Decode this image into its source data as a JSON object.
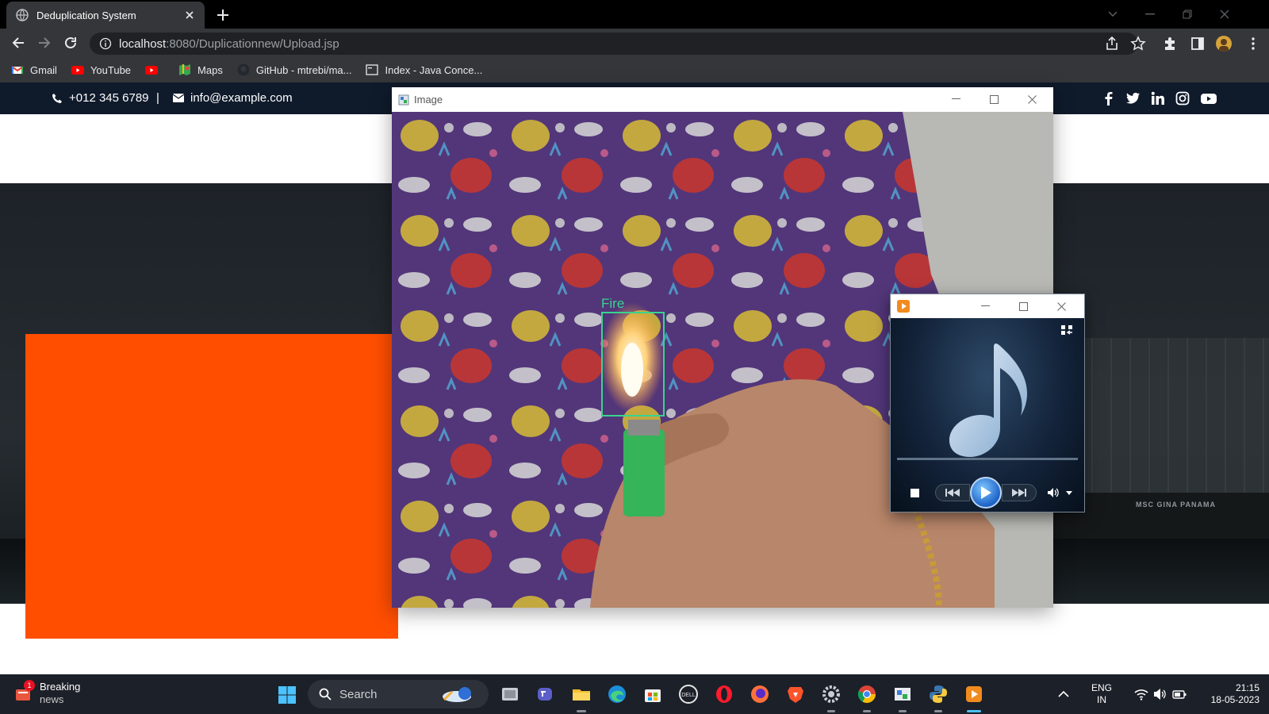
{
  "browser": {
    "tab_title": "Deduplication System",
    "url_host": "localhost",
    "url_rest": ":8080/Duplicationnew/Upload.jsp",
    "bookmarks": [
      {
        "label": "Gmail",
        "icon": "gmail-icon"
      },
      {
        "label": "YouTube",
        "icon": "youtube-icon"
      },
      {
        "label": "",
        "icon": "youtube-icon"
      },
      {
        "label": "Maps",
        "icon": "maps-icon"
      },
      {
        "label": "GitHub - mtrebi/ma...",
        "icon": "github-icon"
      },
      {
        "label": "Index - Java Conce...",
        "icon": "page-icon"
      }
    ]
  },
  "site": {
    "phone": "+012 345 6789",
    "separator": "|",
    "email": "info@example.com",
    "social_icons": [
      "facebook-icon",
      "twitter-icon",
      "linkedin-icon",
      "instagram-icon",
      "youtube-icon"
    ],
    "hero_ship_text": "MSC GINA PANAMA",
    "accent_color": "#ff4e00",
    "topbar_color": "#0f1a2b"
  },
  "image_window": {
    "title": "Image",
    "detection_label": "Fire",
    "detection_color": "#39d48f"
  },
  "media_player": {
    "icon": "music-note-icon"
  },
  "taskbar": {
    "news_title": "Breaking",
    "news_sub": "news",
    "news_badge": "1",
    "search_placeholder": "Search",
    "lang_top": "ENG",
    "lang_bottom": "IN",
    "time": "21:15",
    "date": "18-05-2023"
  }
}
